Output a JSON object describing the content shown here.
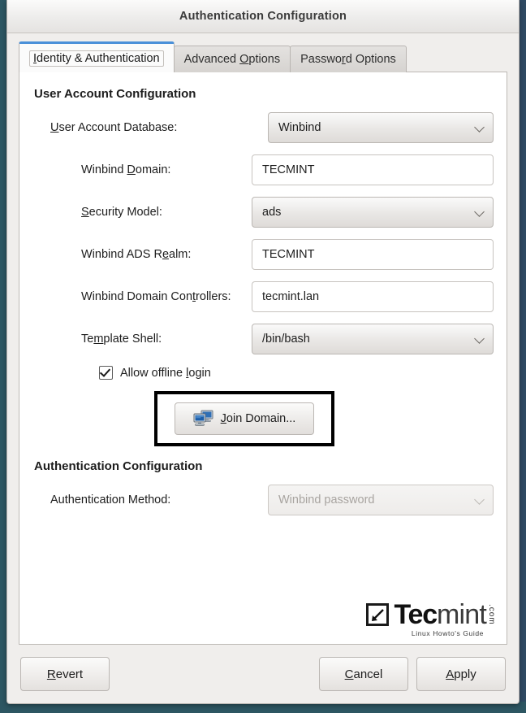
{
  "window": {
    "title": "Authentication Configuration"
  },
  "tabs": [
    {
      "label_pre": "I",
      "label_mn": "",
      "label": "Identity & Authentication",
      "mnemonic_index": 0,
      "active": true
    },
    {
      "label": "Advanced Options",
      "mnemonic_index": 9,
      "active": false
    },
    {
      "label": "Password Options",
      "mnemonic_index": 6,
      "active": false
    }
  ],
  "tab_labels": {
    "identity": "Identity & Authentication",
    "advanced": "Advanced Options",
    "password": "Password Options"
  },
  "user_account_section": {
    "title": "User Account Configuration",
    "fields": {
      "database_label": "User Account Database:",
      "database_value": "Winbind",
      "domain_label": "Winbind Domain:",
      "domain_value": "TECMINT",
      "security_label": "Security Model:",
      "security_value": "ads",
      "realm_label": "Winbind ADS Realm:",
      "realm_value": "TECMINT",
      "controllers_label": "Winbind Domain Controllers:",
      "controllers_value": "tecmint.lan",
      "shell_label": "Template Shell:",
      "shell_value": "/bin/bash"
    },
    "offline_login_label": "Allow offline login",
    "offline_login_checked": true,
    "join_domain_label": "Join Domain..."
  },
  "auth_section": {
    "title": "Authentication Configuration",
    "method_label": "Authentication Method:",
    "method_value": "Winbind password",
    "method_disabled": true
  },
  "watermark": {
    "tec": "Tec",
    "mint": "mint",
    "com": ".com",
    "tagline": "Linux Howto's Guide"
  },
  "footer": {
    "revert": "Revert",
    "cancel": "Cancel",
    "apply": "Apply"
  },
  "icons": {
    "combo_arrow": "chevron-down-icon",
    "join_domain": "network-computers-icon",
    "checkbox": "checkmark-icon"
  },
  "colors": {
    "accent": "#4a90d9",
    "desktop_left": "#2d5662",
    "desktop_right": "#2f4a63",
    "highlight_box": "#000000",
    "window_bg": "#f0eeec",
    "panel_bg": "#ffffff"
  }
}
